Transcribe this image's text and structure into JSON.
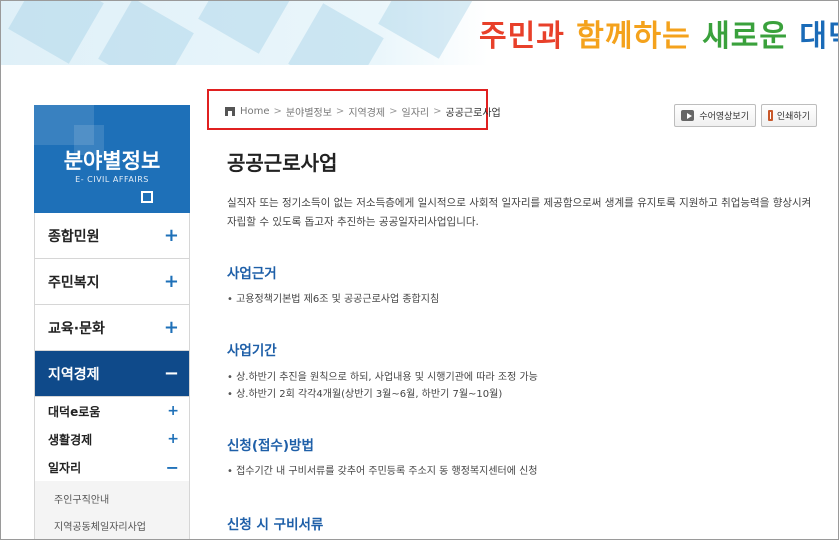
{
  "header": {
    "slogan": {
      "part1": "주민과",
      "part2": "함께하는",
      "part3": "새로운",
      "part4": "대덕"
    },
    "colors": {
      "part1": "#e8402a",
      "part2": "#f4a21c",
      "part3": "#3aa13c",
      "part4": "#1a6bb8"
    }
  },
  "sidebar": {
    "title": "분야별정보",
    "subtitle": "E- CIVIL AFFAIRS",
    "accent": "#1e70b8",
    "active_bg": "#0f4a8a",
    "items": [
      {
        "label": "종합민원",
        "icon": "plus-icon",
        "sign": "+"
      },
      {
        "label": "주민복지",
        "icon": "plus-icon",
        "sign": "+"
      },
      {
        "label": "교육·문화",
        "icon": "plus-icon",
        "sign": "+"
      },
      {
        "label": "지역경제",
        "icon": "minus-icon",
        "sign": "−"
      }
    ],
    "sub_items": [
      {
        "label": "대덕e로움",
        "sign": "+"
      },
      {
        "label": "생활경제",
        "sign": "+"
      },
      {
        "label": "일자리",
        "sign": "−"
      }
    ],
    "leaves": [
      "주인구직안내",
      "지역공동체일자리사업"
    ]
  },
  "breadcrumb": {
    "home": "Home",
    "items": [
      "분야별정보",
      "지역경제",
      "일자리"
    ],
    "current": "공공근로사업",
    "separator": ">"
  },
  "toolbar": {
    "video_label": "수어영상보기",
    "print_label": "인쇄하기"
  },
  "main": {
    "title": "공공근로사업",
    "intro_line1": "실직자 또는 정기소득이 없는 저소득층에게 일시적으로 사회적 일자리를 제공함으로써 생계를 유지토록 지원하고 취업능력을 향상시켜",
    "intro_line2": "자립할 수 있도록 돕고자 추진하는 공공일자리사업입니다.",
    "sections": [
      {
        "title": "사업근거",
        "bullets": [
          "고용정책기본법 제6조 및 공공근로사업 종합지침"
        ]
      },
      {
        "title": "사업기간",
        "bullets": [
          "상.하반기 추진을 원칙으로 하되, 사업내용 및 시행기관에 따라 조정 가능",
          "상.하반기 2회 각각4개월(상반기 3월~6월, 하반기 7월~10월)"
        ]
      },
      {
        "title": "신청(접수)방법",
        "bullets": [
          "접수기간 내 구비서류를 갖추어 주민등록 주소지 동 행정복지센터에 신청"
        ]
      },
      {
        "title": "신청 시 구비서류",
        "bullets": []
      }
    ]
  }
}
